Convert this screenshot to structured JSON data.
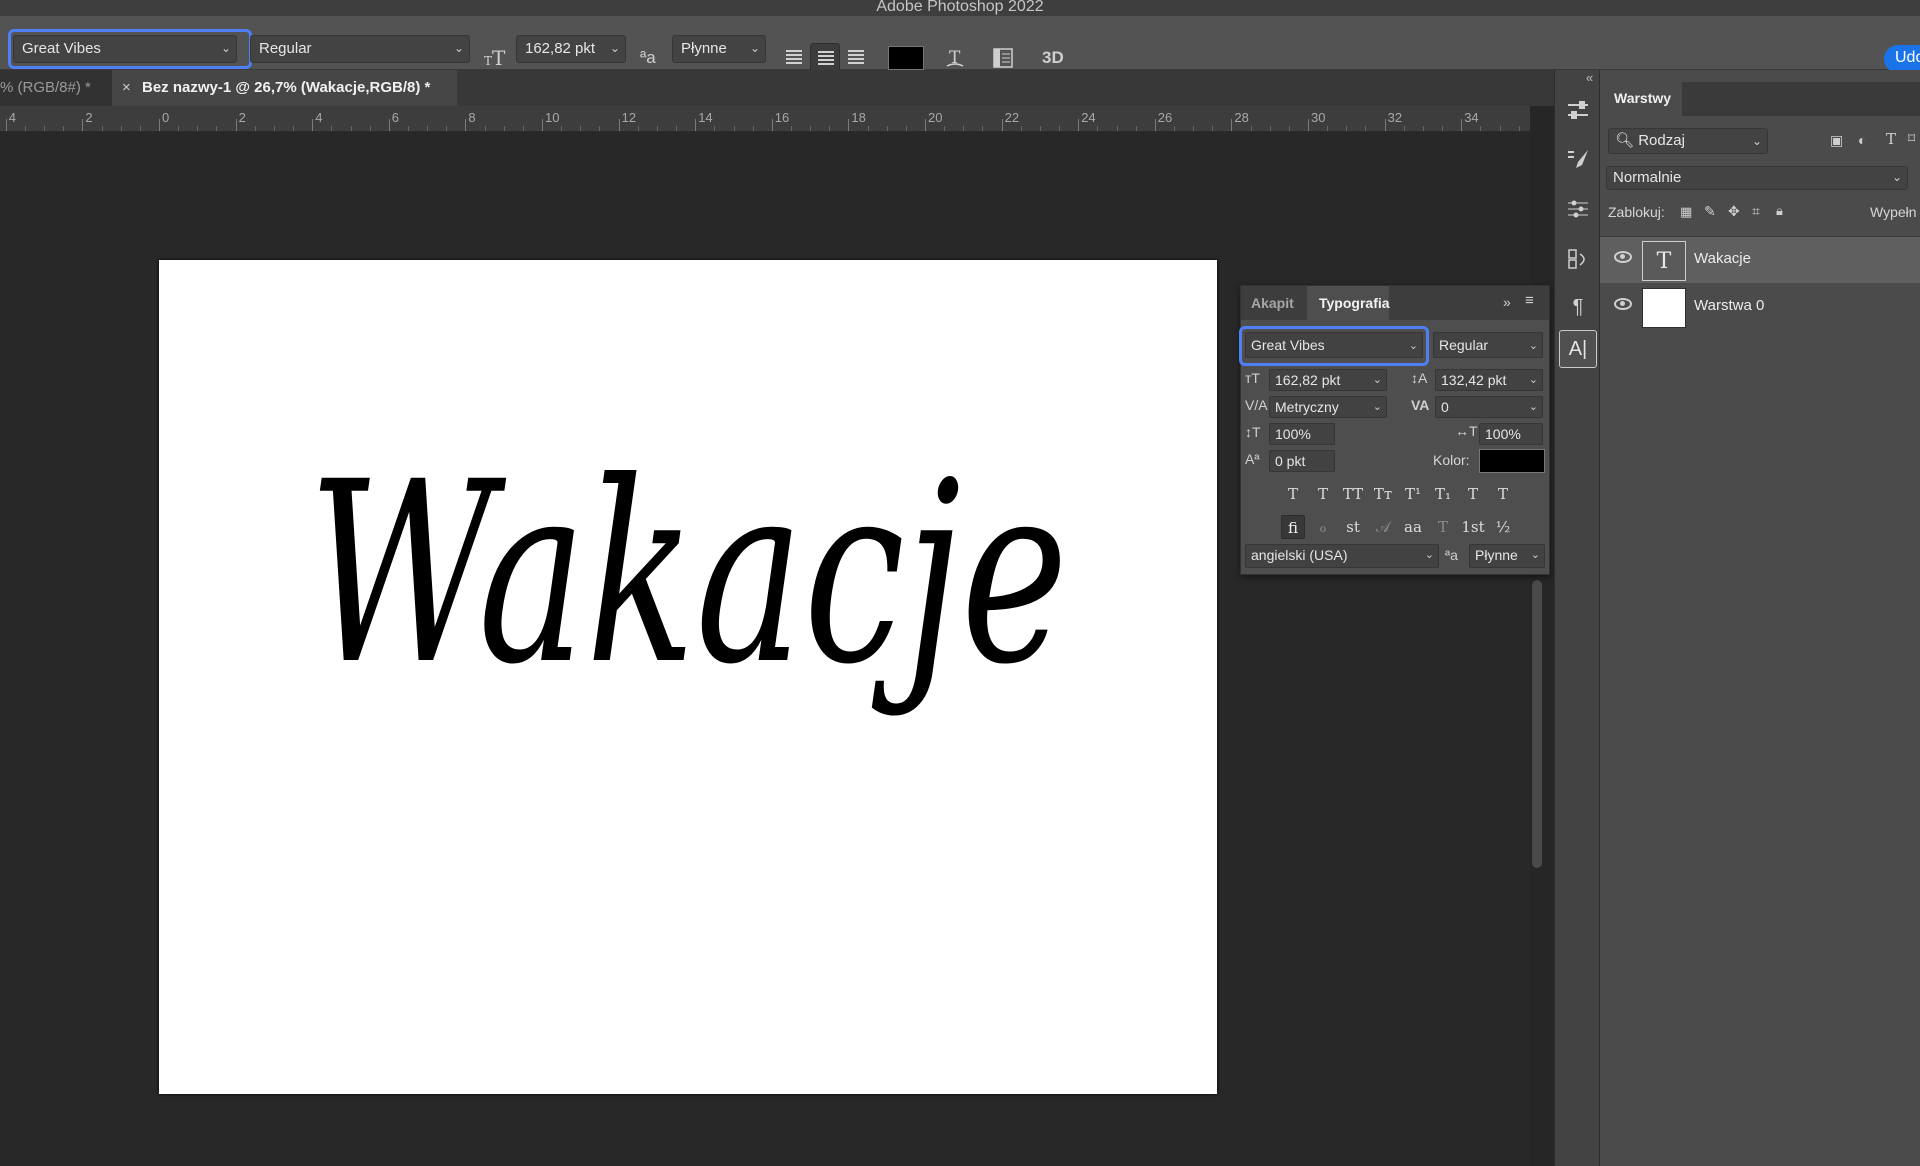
{
  "window": {
    "title": "Adobe Photoshop 2022"
  },
  "options_bar": {
    "font_family": "Great Vibes",
    "font_style": "Regular",
    "font_size": "162,82 pkt",
    "antialias": "Płynne",
    "text_color": "#000000",
    "threed_label": "3D",
    "share_label": "Udostępnij"
  },
  "tabs": [
    {
      "label": "% (RGB/8#) *"
    },
    {
      "label": "Bez nazwy-1 @ 26,7% (Wakacje,RGB/8) *",
      "close": "×"
    }
  ],
  "ruler": {
    "labels": [
      "4",
      "2",
      "0",
      "2",
      "4",
      "6",
      "8",
      "10",
      "12",
      "14",
      "16",
      "18",
      "20",
      "22",
      "24",
      "26",
      "28",
      "30",
      "32",
      "34"
    ]
  },
  "canvas": {
    "text": "Wakacje",
    "text_color": "#000000"
  },
  "typografia_panel": {
    "tabs": [
      "Akapit",
      "Typografia"
    ],
    "active_tab": "Typografia",
    "font_family": "Great Vibes",
    "font_style": "Regular",
    "size": "162,82 pkt",
    "leading": "132,42 pkt",
    "kerning": "Metryczny",
    "tracking": "0",
    "vertical_scale": "100%",
    "horizontal_scale": "100%",
    "baseline_shift": "0 pkt",
    "color_label": "Kolor:",
    "color": "#000000",
    "language": "angielski (USA)",
    "antialias": "Płynne",
    "style_buttons": [
      "T",
      "T",
      "TT",
      "Tт",
      "T¹",
      "T₁",
      "T",
      "T"
    ],
    "opentype_buttons": [
      "ﬁ",
      "ℴ",
      "st",
      "𝒜",
      "aa",
      "T",
      "1st",
      "½"
    ]
  },
  "layers_panel": {
    "tab": "Warstwy",
    "filter_kind": "Rodzaj",
    "blend_mode": "Normalnie",
    "lock_label": "Zablokuj:",
    "fill_label": "Wypełn",
    "layers": [
      {
        "name": "Wakacje",
        "type": "text",
        "selected": true
      },
      {
        "name": "Warstwa 0",
        "type": "pixel",
        "selected": false
      }
    ]
  }
}
